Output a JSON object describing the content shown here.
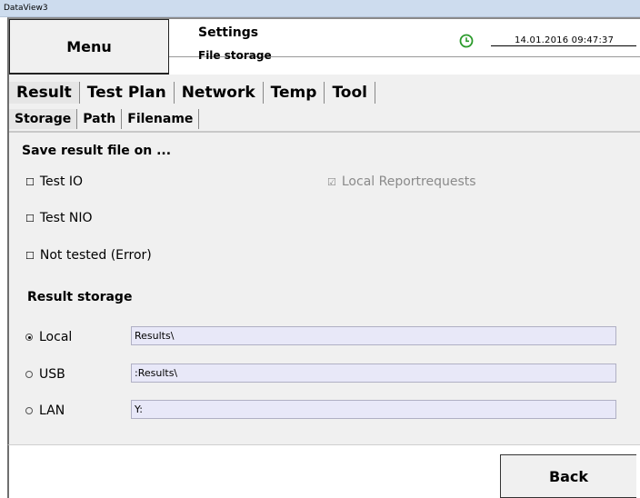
{
  "window": {
    "title": "DataView3"
  },
  "header": {
    "menu_label": "Menu",
    "title": "Settings",
    "subtitle": "File storage",
    "datetime": "14.01.2016  09:47:37"
  },
  "tabs_main": [
    "Result",
    "Test Plan",
    "Network",
    "Temp",
    "Tool"
  ],
  "tabs_sub": [
    "Storage",
    "Path",
    "Filename"
  ],
  "save_section": {
    "heading": "Save result file on ...",
    "options": [
      {
        "label": "Test IO",
        "checked": false
      },
      {
        "label": "Test NIO",
        "checked": false
      },
      {
        "label": "Not tested (Error)",
        "checked": false
      },
      {
        "label": "Local Reportrequests",
        "checked": true,
        "disabled": true
      }
    ]
  },
  "result_storage": {
    "heading": "Result storage",
    "rows": [
      {
        "label": "Local",
        "selected": true,
        "value": "Results\\"
      },
      {
        "label": "USB",
        "selected": false,
        "value": ":Results\\"
      },
      {
        "label": "LAN",
        "selected": false,
        "value": "Y:"
      }
    ]
  },
  "footer": {
    "back_label": "Back"
  },
  "colors": {
    "clock_green": "#2a9a2a",
    "field_bg": "#e8e8f8",
    "panel_bg": "#f0f0f0"
  }
}
